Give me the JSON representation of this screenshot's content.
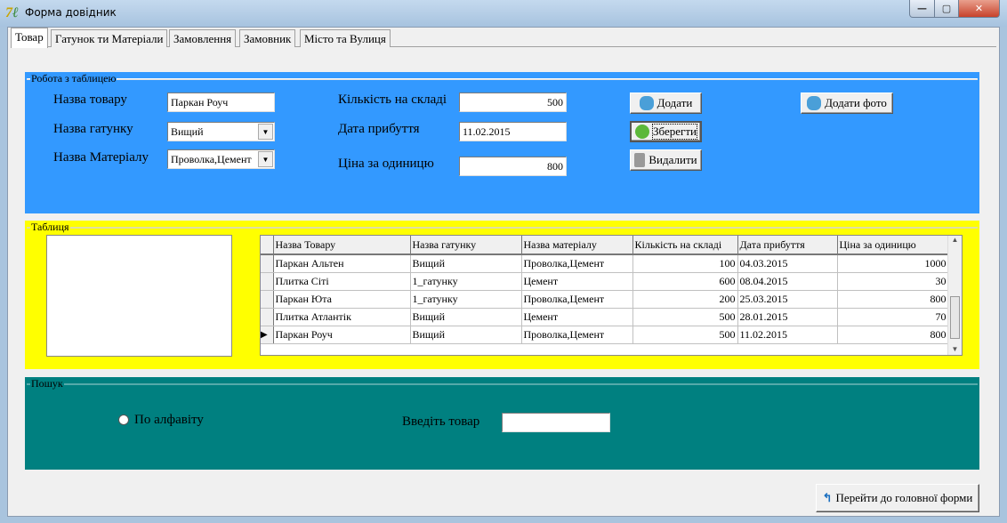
{
  "window": {
    "title": "Форма довідник",
    "minimize": "—",
    "maximize": "▢",
    "close": "✕"
  },
  "tabs": [
    "Товар",
    "Гатунок ти Матеріали",
    "Замовлення",
    "Замовник",
    "Місто та Вулиця"
  ],
  "work": {
    "legend": "Робота з таблицею",
    "name_label": "Назва товару",
    "name_value": "Паркан Роуч",
    "grade_label": "Назва гатунку",
    "grade_value": "Вищий",
    "material_label": "Назва Матеріалу",
    "material_value": "Проволка,Цемент",
    "qty_label": "Кількість на складі",
    "qty_value": "500",
    "date_label": "Дата прибуття",
    "date_value": "11.02.2015",
    "price_label": "Ціна за одиницю",
    "price_value": "800",
    "add": "Додати",
    "save": "Зберегти",
    "delete": "Видалити",
    "add_photo": "Додати фото"
  },
  "table": {
    "legend": "Таблиця",
    "columns": [
      "Назва Товару",
      "Назва гатунку",
      "Назва матеріалу",
      "Кількість на складі",
      "Дата прибуття",
      "Ціна за одиницю"
    ],
    "rows": [
      [
        "Паркан Альтен",
        "Вищий",
        "Проволка,Цемент",
        "100",
        "04.03.2015",
        "1000"
      ],
      [
        "Плитка Сіті",
        "1_гатунку",
        "Цемент",
        "600",
        "08.04.2015",
        "30"
      ],
      [
        "Паркан Юта",
        "1_гатунку",
        "Проволка,Цемент",
        "200",
        "25.03.2015",
        "800"
      ],
      [
        "Плитка Атлантік",
        "Вищий",
        "Цемент",
        "500",
        "28.01.2015",
        "70"
      ],
      [
        "Паркан Роуч",
        "Вищий",
        "Проволка,Цемент",
        "500",
        "11.02.2015",
        "800"
      ]
    ],
    "selected_row": 4
  },
  "search": {
    "legend": "Пошук",
    "alpha_label": "По алфавіту",
    "input_label": "Введіть товар",
    "input_value": ""
  },
  "footer": {
    "main_form": "Перейти до головної форми"
  },
  "colors": {
    "blue": "#3399ff",
    "yellow": "#ffff00",
    "teal": "#008080"
  }
}
